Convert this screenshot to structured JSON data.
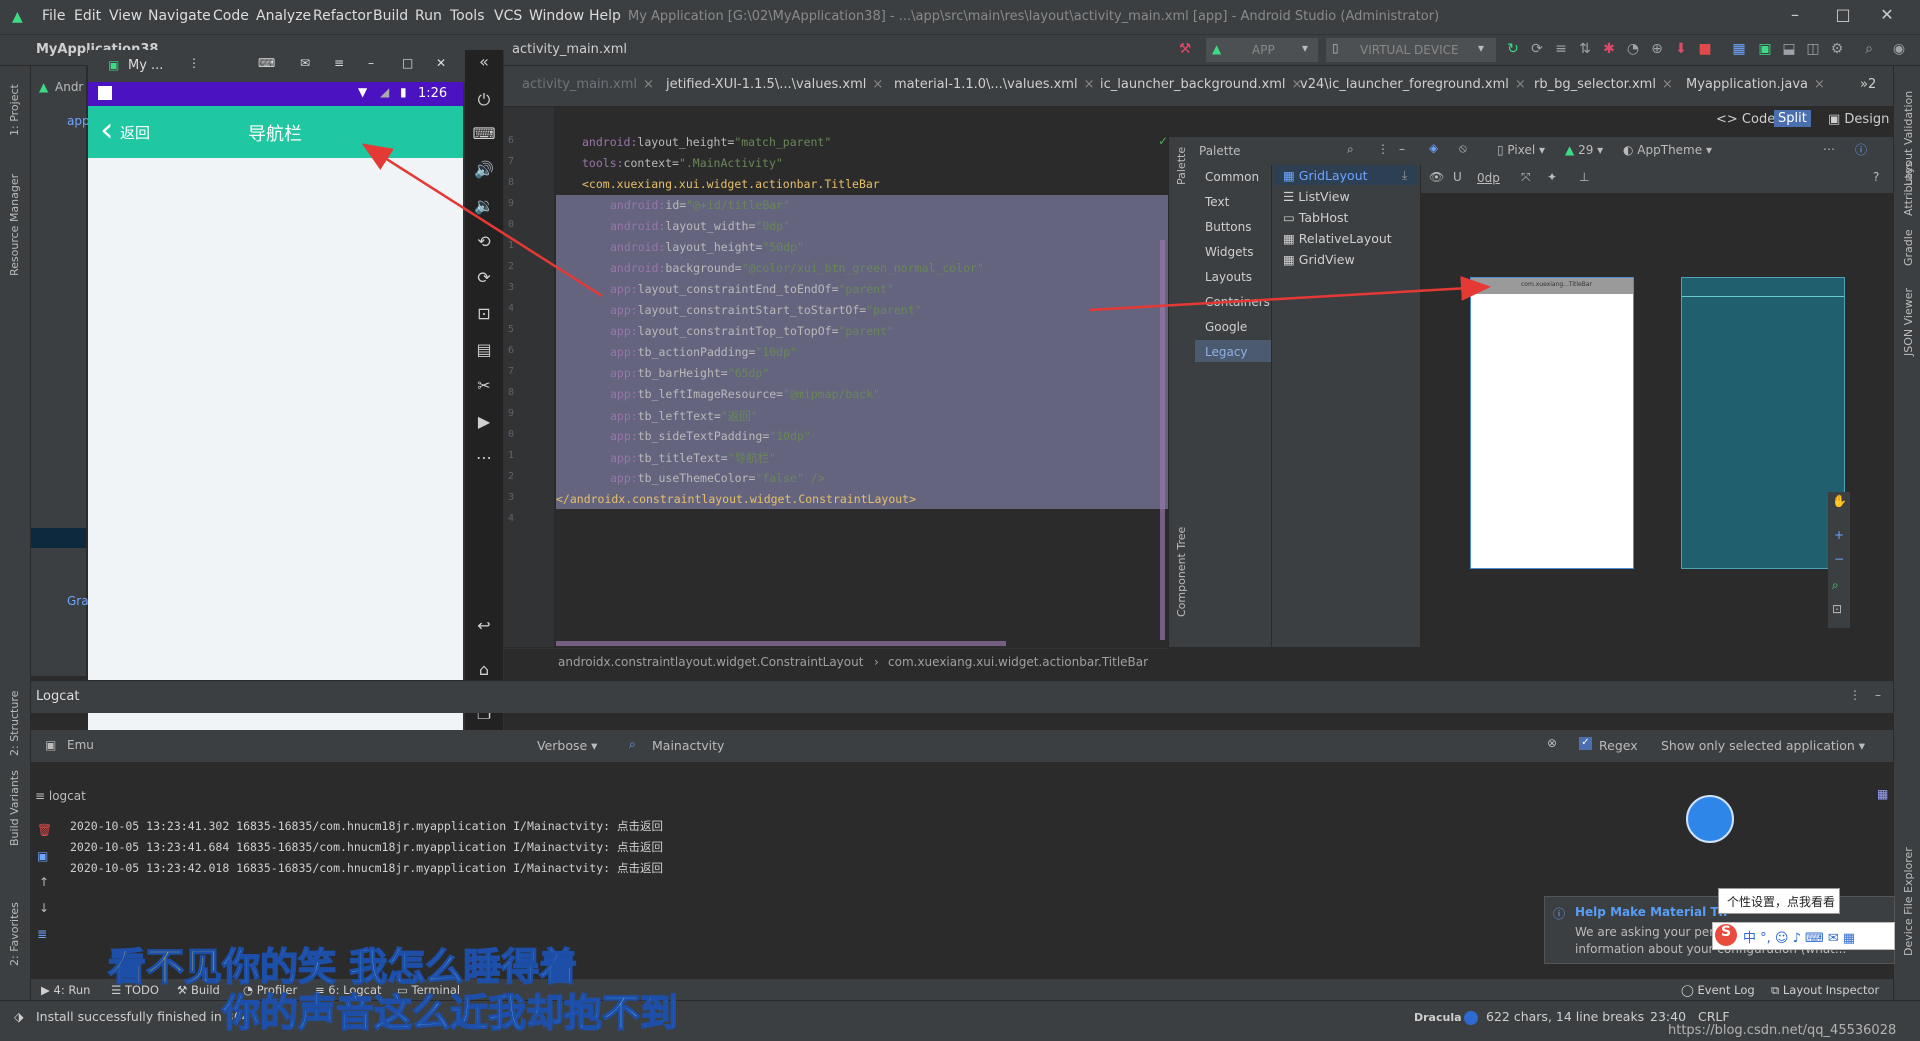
{
  "window": {
    "path": "My Application [G:\\02\\MyApplication38] - ...\\app\\src\\main\\res\\layout\\activity_main.xml [app] - Android Studio (Administrator)",
    "controls": [
      "–",
      "□",
      "✕"
    ]
  },
  "menu": [
    "File",
    "Edit",
    "View",
    "Navigate",
    "Code",
    "Analyze",
    "Refactor",
    "Build",
    "Run",
    "Tools",
    "VCS",
    "Window",
    "Help"
  ],
  "toolbar": {
    "project": "MyApplication38",
    "breadcrumb_file": "activity_main.xml",
    "run_config": "APP",
    "device": "VIRTUAL DEVICE"
  },
  "tabs": [
    {
      "label": "activity_main.xml",
      "active": true
    },
    {
      "label": "jetified-XUI-1.1.5\\...\\values.xml"
    },
    {
      "label": "material-1.1.0\\...\\values.xml"
    },
    {
      "label": "ic_launcher_background.xml"
    },
    {
      "label": "v24\\ic_launcher_foreground.xml"
    },
    {
      "label": "rb_bg_selector.xml"
    },
    {
      "label": "Myapplication.java"
    }
  ],
  "tabs_overflow": "2",
  "view_modes": {
    "code": "Code",
    "split": "Split",
    "design": "Design"
  },
  "left_stripe": {
    "project": "1: Project",
    "resource_manager": "Resource Manager",
    "structure": "2: Structure",
    "build_variants": "Build Variants",
    "favorites": "2: Favorites"
  },
  "right_stripe": {
    "layout_validation": "Layout Validation",
    "attributes": "Attributes",
    "gradle": "Gradle",
    "json_viewer": "JSON Viewer",
    "device_file_explorer": "Device File Explorer"
  },
  "project_panel": {
    "label": "Andr",
    "items": [
      "app",
      "Gra"
    ]
  },
  "emulator": {
    "title": "My ...",
    "status_time": "1:26",
    "back_text": "返回",
    "title_text": "导航栏"
  },
  "code": {
    "lines": [
      {
        "attr": "android:layout_height",
        "val": "\"match_parent\""
      },
      {
        "attr": "tools:context",
        "val": "\".MainActivity\""
      },
      {
        "tag": "<com.xuexiang.xui.widget.actionbar.TitleBar"
      },
      {
        "attr": "android:id",
        "val": "\"@+id/titleBar\""
      },
      {
        "attr": "android:layout_width",
        "val": "\"0dp\""
      },
      {
        "attr": "android:layout_height",
        "val": "\"50dp\""
      },
      {
        "attr": "android:background",
        "val": "\"@color/xui_btn_green_normal_color\""
      },
      {
        "attr": "app:layout_constraintEnd_toEndOf",
        "val": "\"parent\""
      },
      {
        "attr": "app:layout_constraintStart_toStartOf",
        "val": "\"parent\""
      },
      {
        "attr": "app:layout_constraintTop_toTopOf",
        "val": "\"parent\""
      },
      {
        "attr": "app:tb_actionPadding",
        "val": "\"10dp\""
      },
      {
        "attr": "app:tb_barHeight",
        "val": "\"65dp\""
      },
      {
        "attr": "app:tb_leftImageResource",
        "val": "\"@mipmap/back\""
      },
      {
        "attr": "app:tb_leftText",
        "val": "\"返回\""
      },
      {
        "attr": "app:tb_sideTextPadding",
        "val": "\"10dp\""
      },
      {
        "attr": "app:tb_titleText",
        "val": "\"导航栏\""
      },
      {
        "attr": "app:tb_useThemeColor",
        "val": "\"false\" />"
      },
      {
        "tag": "</androidx.constraintlayout.widget.ConstraintLayout>"
      }
    ],
    "line_numbers": [
      "6",
      "7",
      "8",
      "9",
      "0",
      "1",
      "2",
      "3",
      "4",
      "5",
      "6",
      "7",
      "8",
      "9",
      "0",
      "1",
      "2",
      "3",
      "4"
    ]
  },
  "breadcrumb": [
    "androidx.constraintlayout.widget.ConstraintLayout",
    "com.xuexiang.xui.widget.actionbar.TitleBar"
  ],
  "palette": {
    "title": "Palette",
    "categories": [
      "Common",
      "Text",
      "Buttons",
      "Widgets",
      "Layouts",
      "Containers",
      "Google",
      "Legacy"
    ],
    "selected_category": "Legacy",
    "items": [
      "GridLayout",
      "ListView",
      "TabHost",
      "RelativeLayout",
      "GridView"
    ],
    "component_tree": "Component Tree"
  },
  "design": {
    "device": "Pixel",
    "api": "29",
    "theme": "AppTheme",
    "margin": "0dp",
    "preview_label": "com.xuexiang...TitleBar"
  },
  "logcat": {
    "title": "Logcat",
    "device": "Emu",
    "level": "Verbose",
    "filter": "Mainactvity",
    "regex": "Regex",
    "scope": "Show only selected application",
    "tab": "logcat",
    "lines": [
      "2020-10-05 13:23:41.302 16835-16835/com.hnucm18jr.myapplication I/Mainactvity: 点击返回",
      "2020-10-05 13:23:41.684 16835-16835/com.hnucm18jr.myapplication I/Mainactvity: 点击返回",
      "2020-10-05 13:23:42.018 16835-16835/com.hnucm18jr.myapplication I/Mainactvity: 点击返回"
    ]
  },
  "bottom_tools": [
    "4: Run",
    "TODO",
    "Build",
    "Profiler",
    "6: Logcat",
    "Terminal",
    "Event Log",
    "Layout Inspector"
  ],
  "status": {
    "message": "Install successfully finished in 364",
    "theme": "Dracula",
    "chars": "622 chars, 14 line breaks",
    "position": "23:40",
    "line_sep": "CRLF",
    "watermark": "https://blog.csdn.net/qq_45536028"
  },
  "notification": {
    "title": "Help Make Material Th",
    "body1": "We are asking your per",
    "body2": "information about your configuration (what...",
    "tooltip": "个性设置，点我看看"
  },
  "subtitles": {
    "line1_yellow": "看不见",
    "line1_blue": "你的笑 我怎么睡得着",
    "line2": "你的声音这么近我却抱不到"
  },
  "colors": {
    "accent": "#1fc7a2",
    "status": "#4a12c0",
    "selection": "#6e6f8e",
    "arrow": "#e53935"
  }
}
